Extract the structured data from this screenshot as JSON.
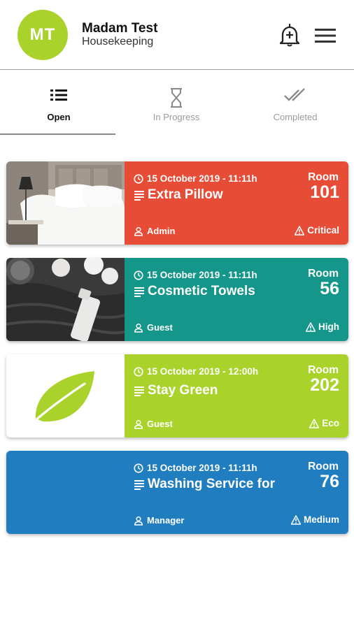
{
  "header": {
    "avatar_initials": "MT",
    "user_name": "Madam Test",
    "user_role": "Housekeeping",
    "avatar_color": "#a9d22b"
  },
  "tabs": [
    {
      "label": "Open",
      "icon": "list-icon",
      "active": true
    },
    {
      "label": "In Progress",
      "icon": "hourglass-icon",
      "active": false
    },
    {
      "label": "Completed",
      "icon": "double-check-icon",
      "active": false
    }
  ],
  "tasks": [
    {
      "date": "15 October 2019 - 11:11h",
      "title": "Extra Pillow",
      "room_label": "Room",
      "room": "101",
      "user": "Admin",
      "priority": "Critical",
      "color": "#e64c36",
      "image": "bedroom-photo"
    },
    {
      "date": "15 October 2019 - 11:11h",
      "title": "Cosmetic Towels",
      "room_label": "Room",
      "room": "56",
      "user": "Guest",
      "priority": "High",
      "color": "#14968a",
      "image": "towels-photo"
    },
    {
      "date": "15 October 2019 - 12:00h",
      "title": "Stay Green",
      "room_label": "Room",
      "room": "202",
      "user": "Guest",
      "priority": "Eco",
      "color": "#a9d22b",
      "image": "leaf-icon"
    },
    {
      "date": "15 October 2019 - 11:11h",
      "title": "Washing Service for",
      "room_label": "Room",
      "room": "76",
      "user": "Manager",
      "priority": "Medium",
      "color": "#1f7dc0",
      "image": "none"
    }
  ]
}
